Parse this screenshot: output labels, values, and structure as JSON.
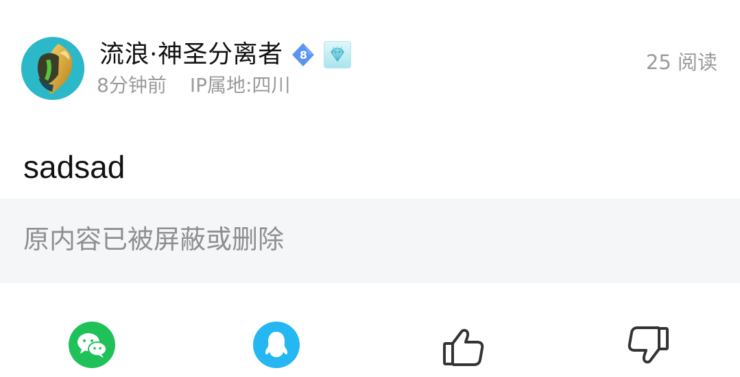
{
  "post": {
    "author": {
      "name": "流浪·神圣分离者",
      "level": "8",
      "avatar_icon": "game-hero-avatar",
      "badge_icon": "diamond-crown-icon"
    },
    "time_ago": "8分钟前",
    "ip_location": "IP属地:四川",
    "read_count": "25 阅读",
    "content": "sadsad",
    "quoted_content": "原内容已被屏蔽或删除"
  },
  "actions": {
    "wechat_icon": "wechat-icon",
    "qq_icon": "qq-icon",
    "like_icon": "thumbs-up-icon",
    "dislike_icon": "thumbs-down-icon"
  },
  "colors": {
    "wechat_green": "#21c15a",
    "qq_blue": "#25b7f2",
    "level_blue": "#5a93f2",
    "muted_text": "#9a9a9a",
    "quote_bg": "#f5f6f8"
  }
}
